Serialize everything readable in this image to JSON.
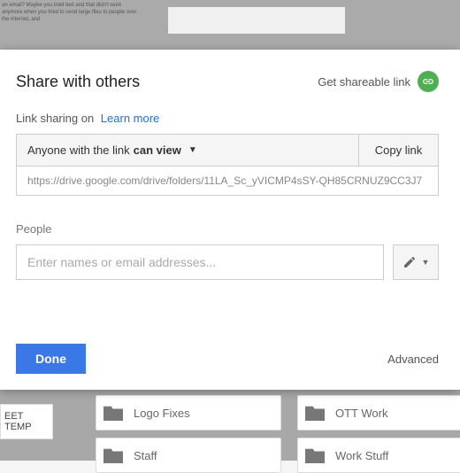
{
  "modal": {
    "title": "Share with others",
    "get_link_label": "Get shareable link",
    "sharing_status": "Link sharing on",
    "learn_more": "Learn more",
    "permission_prefix": "Anyone with the link",
    "permission_mode": "can view",
    "copy_link_label": "Copy link",
    "share_url": "https://drive.google.com/drive/folders/11LA_Sc_yVICMP4sSY-QH85CRNUZ9CC3J7",
    "people_label": "People",
    "people_placeholder": "Enter names or email addresses...",
    "done_label": "Done",
    "advanced_label": "Advanced"
  },
  "backdrop": {
    "tile1": "Logo Fixes",
    "tile2": "OTT Work",
    "tile3": "Staff",
    "tile4": "Work Stuff",
    "side_label": "EET TEMP"
  }
}
